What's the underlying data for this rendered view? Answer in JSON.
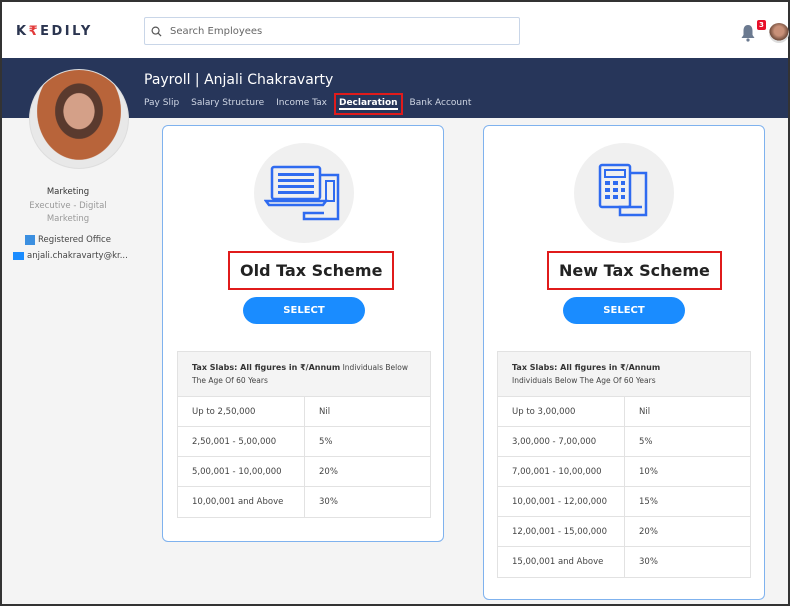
{
  "header": {
    "logo": "KREDILY",
    "search_placeholder": "Search Employees",
    "notification_count": "3"
  },
  "page": {
    "title": "Payroll | Anjali Chakravarty",
    "tabs": [
      "Pay Slip",
      "Salary Structure",
      "Income Tax",
      "Declaration",
      "Bank Account"
    ],
    "active_tab": "Declaration"
  },
  "profile": {
    "department": "Marketing",
    "role": "Executive - Digital Marketing",
    "office": "Registered Office",
    "email": "anjali.chakravarty@kr..."
  },
  "schemes": [
    {
      "title": "Old Tax Scheme",
      "button": "SELECT",
      "slab_header": "Tax Slabs: All figures in ₹/Annum",
      "slab_sub": "Individuals Below The Age Of 60 Years",
      "rows": [
        [
          "Up to 2,50,000",
          "Nil"
        ],
        [
          "2,50,001 - 5,00,000",
          "5%"
        ],
        [
          "5,00,001 - 10,00,000",
          "20%"
        ],
        [
          "10,00,001 and Above",
          "30%"
        ]
      ]
    },
    {
      "title": "New Tax Scheme",
      "button": "SELECT",
      "slab_header": "Tax Slabs: All figures in ₹/Annum",
      "slab_sub": "Individuals Below The Age Of 60 Years",
      "rows": [
        [
          "Up to 3,00,000",
          "Nil"
        ],
        [
          "3,00,000 - 7,00,000",
          "5%"
        ],
        [
          "7,00,001 - 10,00,000",
          "10%"
        ],
        [
          "10,00,001 - 12,00,000",
          "15%"
        ],
        [
          "12,00,001 - 15,00,000",
          "20%"
        ],
        [
          "15,00,001 and Above",
          "30%"
        ]
      ]
    }
  ]
}
